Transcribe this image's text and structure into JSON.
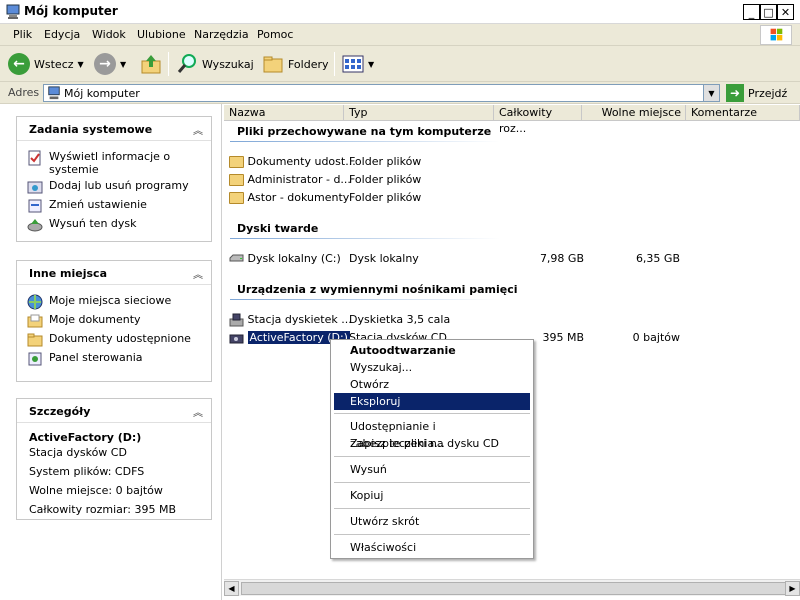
{
  "window": {
    "title": "Mój komputer"
  },
  "menu": [
    "Plik",
    "Edycja",
    "Widok",
    "Ulubione",
    "Narzędzia",
    "Pomoc"
  ],
  "toolbar": {
    "back": "Wstecz",
    "search": "Wyszukaj",
    "folders": "Foldery"
  },
  "address": {
    "label": "Adres",
    "value": "Mój komputer",
    "go": "Przejdź"
  },
  "panels": {
    "system": {
      "title": "Zadania systemowe",
      "items": [
        "Wyświetl informacje o systemie",
        "Dodaj lub usuń programy",
        "Zmień ustawienie",
        "Wysuń ten dysk"
      ]
    },
    "places": {
      "title": "Inne miejsca",
      "items": [
        "Moje miejsca sieciowe",
        "Moje dokumenty",
        "Dokumenty udostępnione",
        "Panel sterowania"
      ]
    },
    "details": {
      "title": "Szczegóły",
      "name": "ActiveFactory (D:)",
      "type": "Stacja dysków CD",
      "fs": "System plików: CDFS",
      "free": "Wolne miejsce: 0 bajtów",
      "total": "Całkowity rozmiar: 395 MB"
    }
  },
  "columns": [
    "Nazwa",
    "Typ",
    "Całkowity roz...",
    "Wolne miejsce",
    "Komentarze"
  ],
  "groups": {
    "files": {
      "title": "Pliki przechowywane na tym komputerze",
      "items": [
        {
          "name": "Dokumenty udost...",
          "type": "Folder plików"
        },
        {
          "name": "Administrator - d...",
          "type": "Folder plików"
        },
        {
          "name": "Astor - dokumenty",
          "type": "Folder plików"
        }
      ]
    },
    "hdd": {
      "title": "Dyski twarde",
      "items": [
        {
          "name": "Dysk lokalny (C:)",
          "type": "Dysk lokalny",
          "total": "7,98 GB",
          "free": "6,35 GB"
        }
      ]
    },
    "removable": {
      "title": "Urządzenia z wymiennymi nośnikami pamięci",
      "items": [
        {
          "name": "Stacja dyskietek ...",
          "type": "Dyskietka 3,5 cala"
        },
        {
          "name": "ActiveFactory (D:)",
          "type": "Stacja dysków CD",
          "total": "395 MB",
          "free": "0 bajtów"
        }
      ]
    }
  },
  "context_menu": [
    "Autoodtwarzanie",
    "Wyszukaj...",
    "Otwórz",
    "Eksploruj",
    "Udostępnianie i zabezpieczenia...",
    "Zapisz te pliki na dysku CD",
    "Wysuń",
    "Kopiuj",
    "Utwórz skrót",
    "Właściwości"
  ],
  "colors": {
    "highlight": "#0a246a",
    "selection_bg": "#0a246a"
  }
}
